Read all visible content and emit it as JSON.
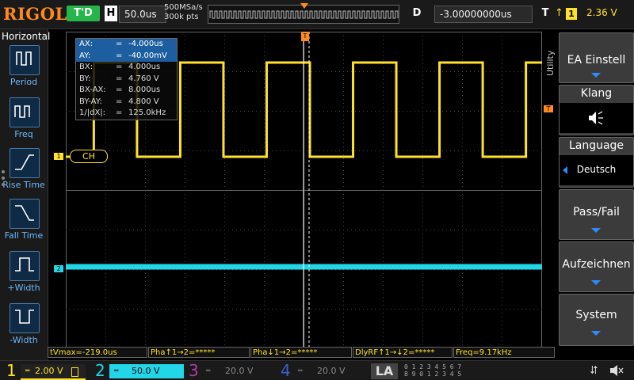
{
  "brand": "RIGOL",
  "trigger_status": "T'D",
  "timebase": {
    "key": "H",
    "value": "50.0us"
  },
  "acquisition": {
    "sample_rate": "500MSa/s",
    "memory_depth": "300k pts"
  },
  "delay": {
    "key": "D",
    "value": "-3.00000000us"
  },
  "trigger": {
    "key": "T",
    "source": "1",
    "level": "2.36 V"
  },
  "left_panel": {
    "title": "Horizontal",
    "items": [
      {
        "label": "Period",
        "icon": "period-icon"
      },
      {
        "label": "Freq",
        "icon": "frequency-icon"
      },
      {
        "label": "Rise Time",
        "icon": "rise-time-icon"
      },
      {
        "label": "Fall Time",
        "icon": "fall-time-icon"
      },
      {
        "label": "+Width",
        "icon": "positive-width-icon"
      },
      {
        "label": "-Width",
        "icon": "negative-width-icon"
      }
    ]
  },
  "cursor_table": [
    {
      "k": "AX:",
      "v": "-4.000us"
    },
    {
      "k": "AY:",
      "v": "-40.00mV"
    },
    {
      "k": "BX:",
      "v": "4.000us"
    },
    {
      "k": "BY:",
      "v": "4.760 V"
    },
    {
      "k": "BX-AX:",
      "v": "8.000us"
    },
    {
      "k": "BY-AY:",
      "v": "4.800 V"
    },
    {
      "k": "1/|dX|:",
      "v": "125.0kHz"
    }
  ],
  "cursor_eq": "=",
  "ch_tag": "CH",
  "markers": {
    "ch1": "1",
    "ch2": "2",
    "trigger_level": "T",
    "trigger_pos": "T"
  },
  "utility_label": "Utility",
  "right_panel": {
    "ea_einstell": "EA Einstell",
    "klang": "Klang",
    "language": "Language",
    "language_value": "Deutsch",
    "pass_fail": "Pass/Fail",
    "aufzeichnen": "Aufzeichnen",
    "system": "System"
  },
  "measurements": [
    "tVmax=-219.0us",
    "Pha↑1→2=*****",
    "Pha↓1→2=*****",
    "DlyRF↑1→↓2=*****",
    "Freq=9.17kHz"
  ],
  "channels": [
    {
      "num": "1",
      "scale": "2.00 V",
      "color": "#ffe12a",
      "active": true
    },
    {
      "num": "2",
      "scale": "50.0 V",
      "color": "#22d6e8",
      "active": true
    },
    {
      "num": "3",
      "scale": "20.0 V",
      "color": "#b03aa6",
      "active": false
    },
    {
      "num": "4",
      "scale": "20.0 V",
      "color": "#3a5fd0",
      "active": false
    }
  ],
  "la_label": "LA",
  "la_bits_top": "0 1 2 3   4 5 6 7",
  "la_bits_bottom": "8 9 0 1   2 3 4 5",
  "colors": {
    "ch1": "#ffe12a",
    "ch2": "#22d6e8",
    "trigger": "#ff8a1a",
    "accent": "#2a8cff",
    "status_green": "#26b54a"
  },
  "waveform": {
    "ch1": {
      "type": "square",
      "frequency_khz": 9.17,
      "high_v": 4.76,
      "low_v": -0.04,
      "v_per_div": 2.0
    },
    "ch2": {
      "type": "flat",
      "v_per_div": 50.0
    }
  }
}
